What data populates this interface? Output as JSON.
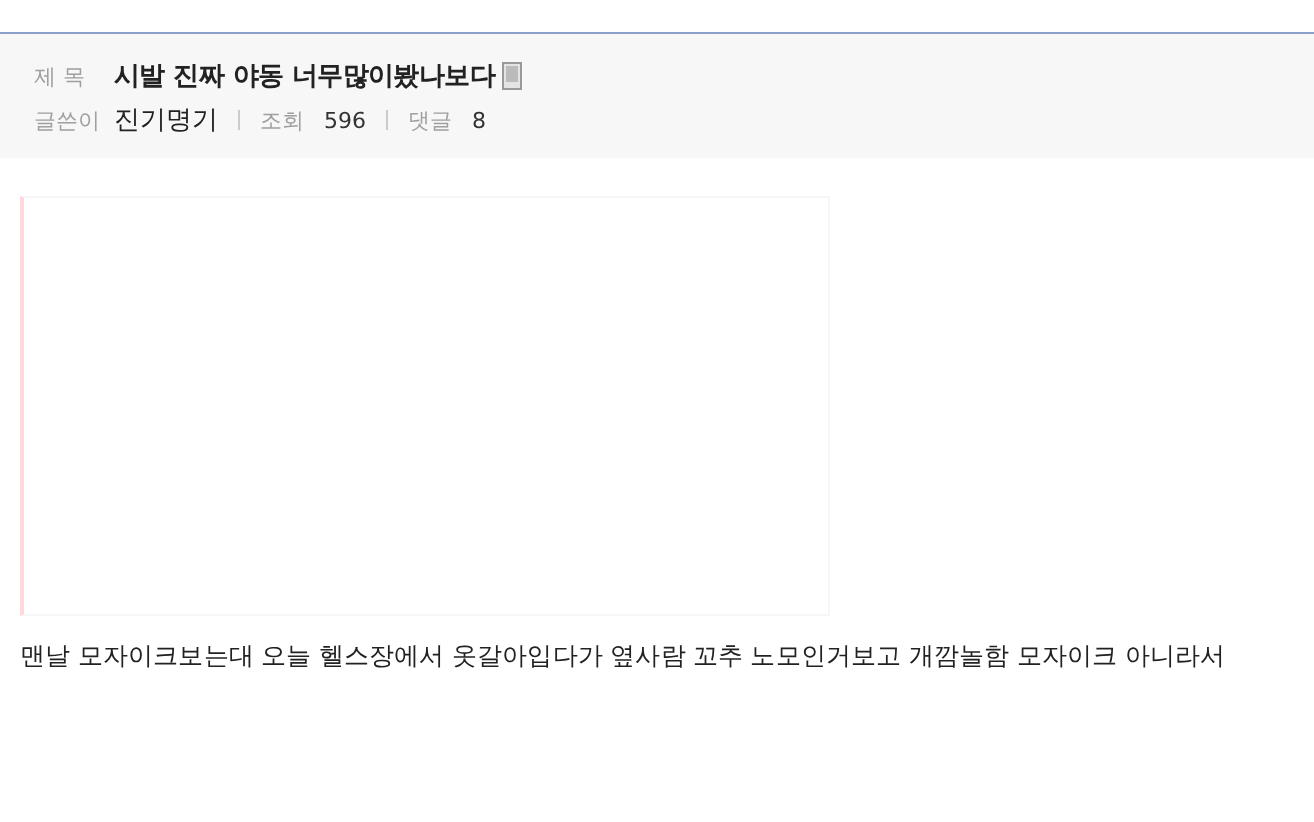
{
  "post": {
    "title_label": "제 목",
    "title": "시발 진짜 야동 너무많이봤나보다",
    "author_label": "글쓴이",
    "author": "진기명기",
    "views_label": "조회",
    "views": "596",
    "comments_label": "댓글",
    "comments": "8"
  },
  "body": {
    "text": "맨날 모자이크보는대 오늘 헬스장에서 옷갈아입다가 옆사람 꼬추 노모인거보고 개깜놀함 모자이크 아니라서"
  }
}
